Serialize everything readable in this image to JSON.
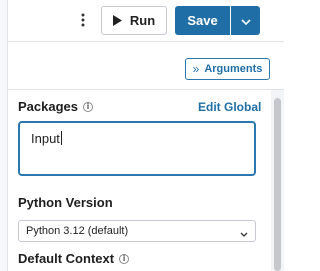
{
  "toolbar": {
    "more_icon": "kebab-icon",
    "run_label": "Run",
    "run_icon": "play-icon",
    "save_label": "Save",
    "save_caret_icon": "chevron-down-icon"
  },
  "panel": {
    "arguments_label": "Arguments",
    "arguments_icon": "double-chevron-right-icon"
  },
  "packages": {
    "label": "Packages",
    "info_icon": "info-icon",
    "edit_global_label": "Edit Global",
    "input_value": "Input"
  },
  "python_version": {
    "label": "Python Version",
    "selected": "Python 3.12 (default)"
  },
  "default_context": {
    "label": "Default Context",
    "info_icon": "info-icon"
  },
  "colors": {
    "accent": "#1f6fa6",
    "border": "#c7cbd1",
    "divider": "#dfe2e6"
  }
}
